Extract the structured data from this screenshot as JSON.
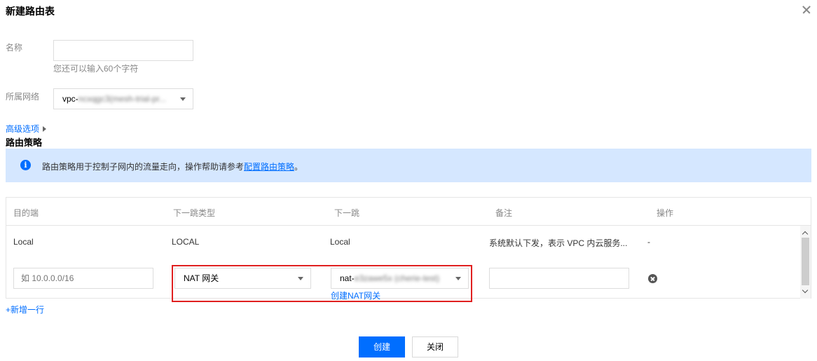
{
  "dialog": {
    "title": "新建路由表",
    "close_icon": "close-icon"
  },
  "form": {
    "name": {
      "label": "名称",
      "value": "",
      "hint": "您还可以输入60个字符"
    },
    "network": {
      "label": "所属网络",
      "value_prefix": "vpc-",
      "value_blurred": "ncxqgc3(mesh-trial-pr..."
    },
    "advanced_link": "高级选项"
  },
  "route_policy": {
    "title": "路由策略",
    "info_text": "路由策略用于控制子网内的流量走向，操作帮助请参考",
    "info_link": "配置路由策略",
    "info_suffix": "。"
  },
  "table": {
    "headers": [
      "目的端",
      "下一跳类型",
      "下一跳",
      "备注",
      "操作"
    ],
    "default_row": {
      "destination": "Local",
      "next_hop_type": "LOCAL",
      "next_hop": "Local",
      "remark": "系统默认下发，表示 VPC 内云服务...",
      "action": "-"
    },
    "edit_row": {
      "destination_placeholder": "如 10.0.0.0/16",
      "next_hop_type": "NAT 网关",
      "next_hop_prefix": "nat-",
      "next_hop_blurred": "e3zawe5x (cherie-test)",
      "create_nat_link": "创建NAT网关",
      "remark_value": ""
    },
    "add_row_link": "+新增一行"
  },
  "footer": {
    "create_label": "创建",
    "close_label": "关闭"
  },
  "colors": {
    "primary": "#006eff",
    "info_bg": "#d5e7ff",
    "highlight_border": "#e02020"
  }
}
